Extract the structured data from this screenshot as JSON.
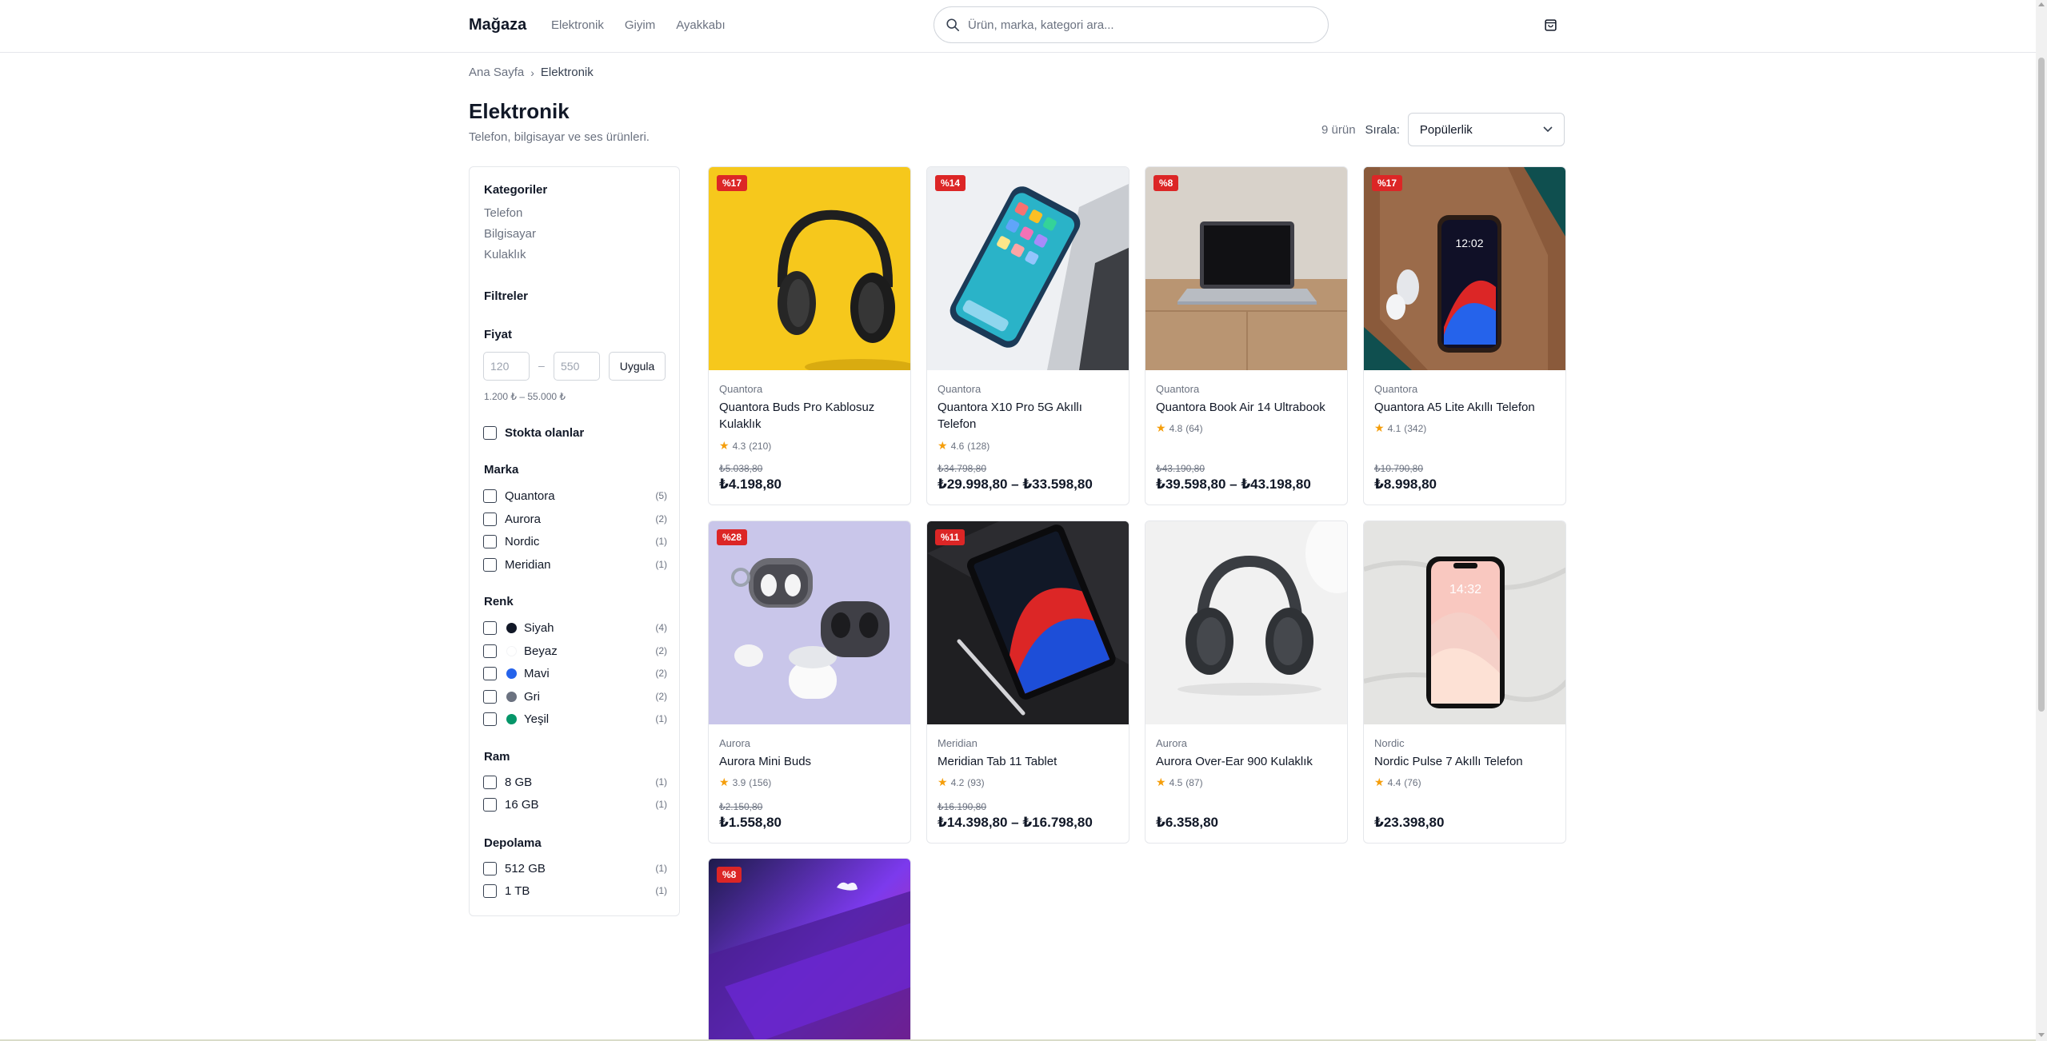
{
  "header": {
    "logo": "Mağaza",
    "nav": [
      "Elektronik",
      "Giyim",
      "Ayakkabı"
    ],
    "search_placeholder": "Ürün, marka, kategori ara..."
  },
  "breadcrumb": {
    "home": "Ana Sayfa",
    "separator": "›",
    "current": "Elektronik"
  },
  "page": {
    "title": "Elektronik",
    "subtitle": "Telefon, bilgisayar ve ses ürünleri.",
    "result_count": "9 ürün",
    "sort_label": "Sırala:",
    "sort_value": "Popülerlik"
  },
  "sidebar": {
    "categories_title": "Kategoriler",
    "categories": [
      "Telefon",
      "Bilgisayar",
      "Kulaklık"
    ],
    "filters_title": "Filtreler",
    "price_title": "Fiyat",
    "price_min_placeholder": "120",
    "price_max_placeholder": "550",
    "price_dash": "–",
    "apply_label": "Uygula",
    "price_range": "1.200 ₺ – 55.000 ₺",
    "in_stock_label": "Stokta olanlar",
    "brand_title": "Marka",
    "brands": [
      {
        "label": "Quantora",
        "count": "(5)"
      },
      {
        "label": "Aurora",
        "count": "(2)"
      },
      {
        "label": "Nordic",
        "count": "(1)"
      },
      {
        "label": "Meridian",
        "count": "(1)"
      }
    ],
    "color_title": "Renk",
    "colors": [
      {
        "label": "Siyah",
        "count": "(4)",
        "swatch": "#111827"
      },
      {
        "label": "Beyaz",
        "count": "(2)",
        "swatch": "#ffffff"
      },
      {
        "label": "Mavi",
        "count": "(2)",
        "swatch": "#2563eb"
      },
      {
        "label": "Gri",
        "count": "(2)",
        "swatch": "#6b7280"
      },
      {
        "label": "Yeşil",
        "count": "(1)",
        "swatch": "#059669"
      }
    ],
    "ram_title": "Ram",
    "ram": [
      {
        "label": "8 GB",
        "count": "(1)"
      },
      {
        "label": "16 GB",
        "count": "(1)"
      }
    ],
    "storage_title": "Depolama",
    "storage": [
      {
        "label": "512 GB",
        "count": "(1)"
      },
      {
        "label": "1 TB",
        "count": "(1)"
      }
    ]
  },
  "products": [
    {
      "badge": "%17",
      "brand": "Quantora",
      "name": "Quantora Buds Pro Kablosuz Kulaklık",
      "rating": "4.3",
      "reviews": "(210)",
      "old_price": "₺5.038,80",
      "price": "₺4.198,80",
      "image": "headphones-yellow"
    },
    {
      "badge": "%14",
      "brand": "Quantora",
      "name": "Quantora X10 Pro 5G Akıllı Telefon",
      "rating": "4.6",
      "reviews": "(128)",
      "old_price": "₺34.798,80",
      "price": "₺29.998,80 – ₺33.598,80",
      "image": "phone-laptop"
    },
    {
      "badge": "%8",
      "brand": "Quantora",
      "name": "Quantora Book Air 14 Ultrabook",
      "rating": "4.8",
      "reviews": "(64)",
      "old_price": "₺43.190,80",
      "price": "₺39.598,80 – ₺43.198,80",
      "image": "laptop-desk"
    },
    {
      "badge": "%17",
      "brand": "Quantora",
      "name": "Quantora A5 Lite Akıllı Telefon",
      "rating": "4.1",
      "reviews": "(342)",
      "old_price": "₺10.790,80",
      "price": "₺8.998,80",
      "image": "phone-wood"
    },
    {
      "badge": "%28",
      "brand": "Aurora",
      "name": "Aurora Mini Buds",
      "rating": "3.9",
      "reviews": "(156)",
      "old_price": "₺2.150,80",
      "price": "₺1.558,80",
      "image": "earbuds-lilac"
    },
    {
      "badge": "%11",
      "brand": "Meridian",
      "name": "Meridian Tab 11 Tablet",
      "rating": "4.2",
      "reviews": "(93)",
      "old_price": "₺16.190,80",
      "price": "₺14.398,80 – ₺16.798,80",
      "image": "tablet-dark"
    },
    {
      "badge": "",
      "brand": "Aurora",
      "name": "Aurora Over-Ear 900 Kulaklık",
      "rating": "4.5",
      "reviews": "(87)",
      "old_price": "",
      "price": "₺6.358,80",
      "image": "headphones-white"
    },
    {
      "badge": "",
      "brand": "Nordic",
      "name": "Nordic Pulse 7 Akıllı Telefon",
      "rating": "4.4",
      "reviews": "(76)",
      "old_price": "",
      "price": "₺23.398,80",
      "image": "phone-sheet"
    },
    {
      "badge": "%8",
      "brand": "",
      "name": "",
      "rating": "",
      "reviews": "",
      "old_price": "",
      "price": "",
      "image": "laptop-purple"
    }
  ],
  "colors": {
    "badge": "#dc2626",
    "star": "#f59e0b",
    "text": "#111827",
    "muted": "#6b7280",
    "border": "#e5e7eb"
  }
}
